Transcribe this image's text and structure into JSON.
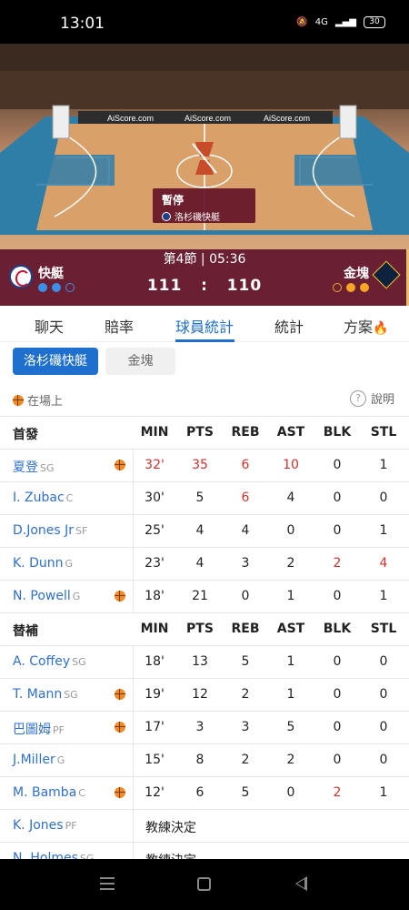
{
  "status": {
    "time": "13:01",
    "network": "4G",
    "battery": "30"
  },
  "court": {
    "banners": [
      "AiScore.com",
      "AiScore.com",
      "AiScore.com"
    ],
    "pause_label": "暫停",
    "pause_team": "洛杉磯快艇"
  },
  "scoreboard": {
    "period": "第4節 | 05:36",
    "home_name": "快艇",
    "away_name": "金塊",
    "home_score": "111",
    "separator": ":",
    "away_score": "110"
  },
  "tabs": [
    {
      "label": "聊天"
    },
    {
      "label": "賠率"
    },
    {
      "label": "球員統計"
    },
    {
      "label": "統計"
    },
    {
      "label": "方案"
    }
  ],
  "team_toggle": {
    "home": "洛杉磯快艇",
    "away": "金塊"
  },
  "legend": {
    "on_court": "在場上",
    "help": "說明"
  },
  "starters": {
    "header": {
      "title": "首發",
      "cols": [
        "MIN",
        "PTS",
        "REB",
        "AST",
        "BLK",
        "STL"
      ]
    },
    "rows": [
      {
        "name": "夏登",
        "pos": "SG",
        "min": "32'",
        "pts": "35",
        "reb": "6",
        "ast": "10",
        "blk": "0",
        "stl": "1"
      },
      {
        "name": "I. Zubac",
        "pos": "C",
        "min": "30'",
        "pts": "5",
        "reb": "6",
        "ast": "4",
        "blk": "0",
        "stl": "0"
      },
      {
        "name": "D.Jones Jr",
        "pos": "SF",
        "min": "25'",
        "pts": "4",
        "reb": "4",
        "ast": "0",
        "blk": "0",
        "stl": "1"
      },
      {
        "name": "K. Dunn",
        "pos": "G",
        "min": "23'",
        "pts": "4",
        "reb": "3",
        "ast": "2",
        "blk": "2",
        "stl": "4"
      },
      {
        "name": "N. Powell",
        "pos": "G",
        "min": "18'",
        "pts": "21",
        "reb": "0",
        "ast": "1",
        "blk": "0",
        "stl": "1"
      }
    ]
  },
  "bench": {
    "header": {
      "title": "替補",
      "cols": [
        "MIN",
        "PTS",
        "REB",
        "AST",
        "BLK",
        "STL"
      ]
    },
    "rows": [
      {
        "name": "A. Coffey",
        "pos": "SG",
        "min": "18'",
        "pts": "13",
        "reb": "5",
        "ast": "1",
        "blk": "0",
        "stl": "0"
      },
      {
        "name": "T. Mann",
        "pos": "SG",
        "min": "19'",
        "pts": "12",
        "reb": "2",
        "ast": "1",
        "blk": "0",
        "stl": "0"
      },
      {
        "name": "巴圖姆",
        "pos": "PF",
        "min": "17'",
        "pts": "3",
        "reb": "3",
        "ast": "5",
        "blk": "0",
        "stl": "0"
      },
      {
        "name": "J.Miller",
        "pos": "G",
        "min": "15'",
        "pts": "8",
        "reb": "2",
        "ast": "2",
        "blk": "0",
        "stl": "0"
      },
      {
        "name": "M. Bamba",
        "pos": "C",
        "min": "12'",
        "pts": "6",
        "reb": "5",
        "ast": "0",
        "blk": "2",
        "stl": "1"
      },
      {
        "name": "K. Jones",
        "pos": "PF",
        "note": "教練決定"
      },
      {
        "name": "N. Holmes",
        "pos": "SG",
        "note": "教練決定"
      }
    ]
  }
}
